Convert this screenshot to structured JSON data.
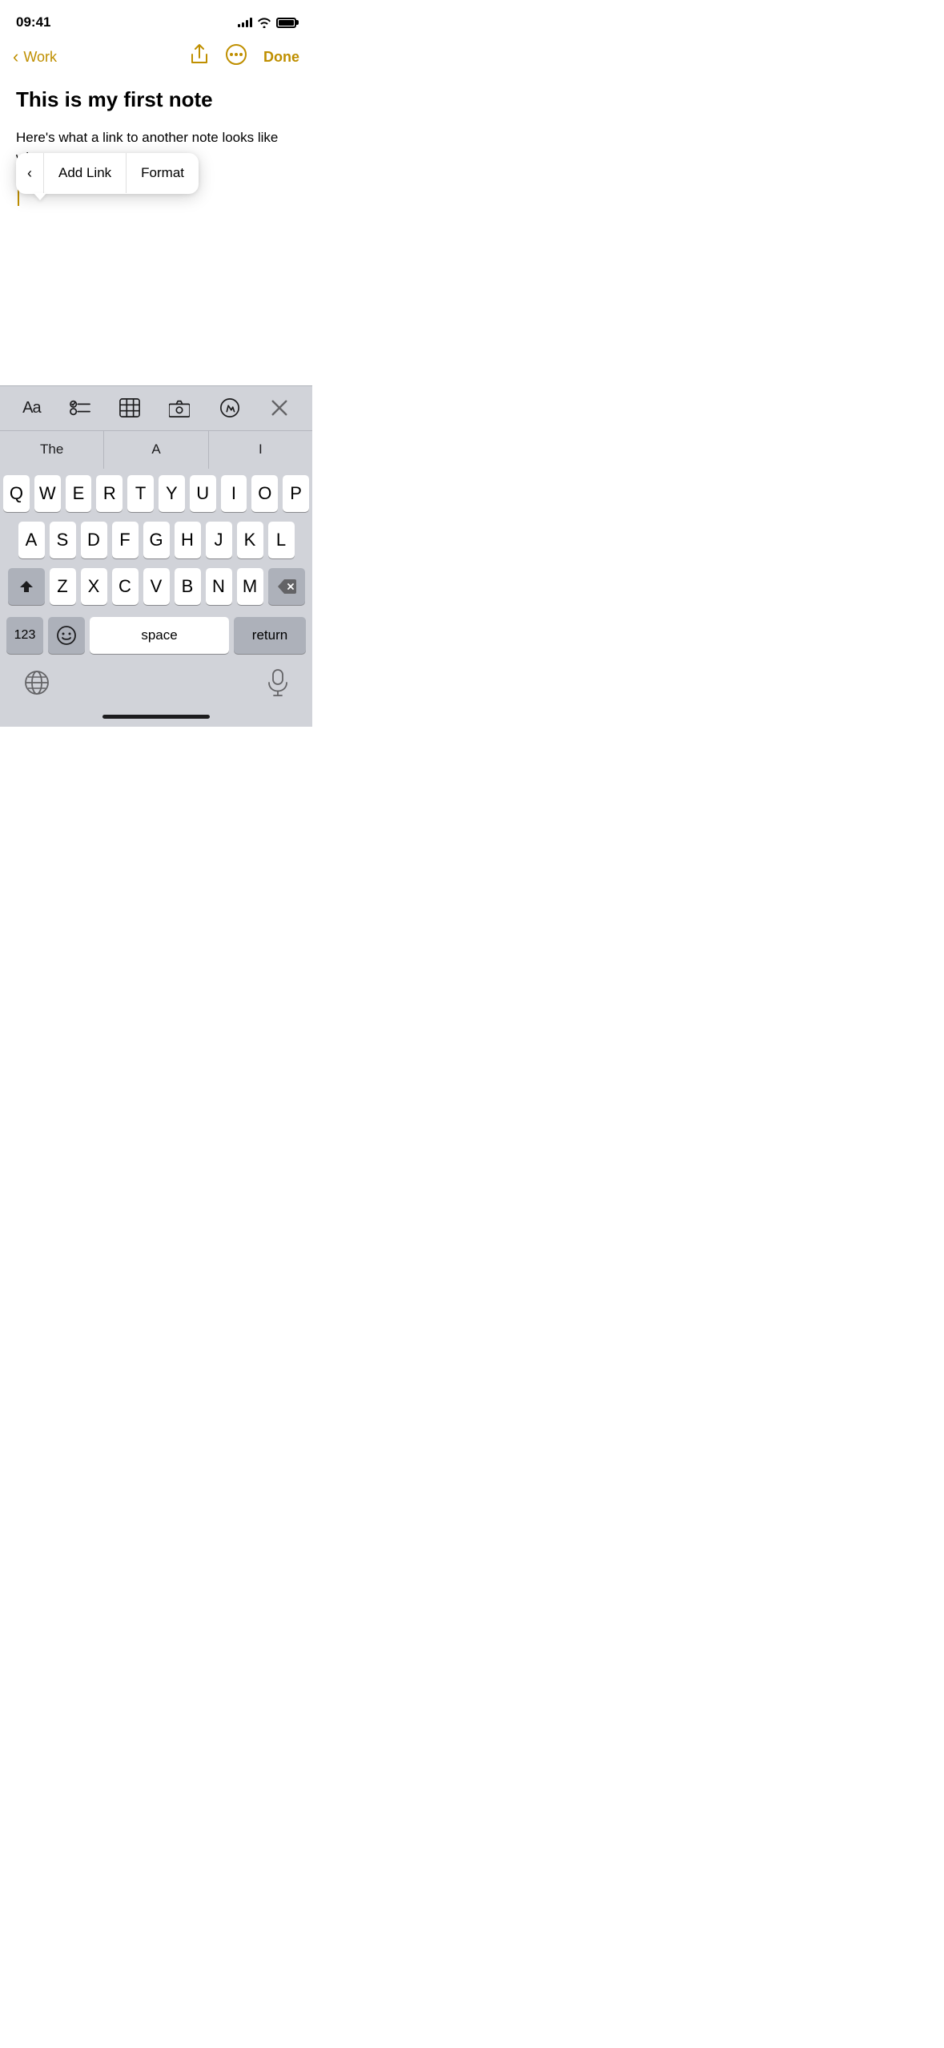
{
  "statusBar": {
    "time": "09:41"
  },
  "navBar": {
    "backLabel": "Work",
    "doneLabel": "Done"
  },
  "note": {
    "title": "This is my first note",
    "bodyText": "Here's what a link to another note looks like when"
  },
  "popupMenu": {
    "backIcon": "‹",
    "addLinkLabel": "Add Link",
    "formatLabel": "Format"
  },
  "toolbar": {
    "aaLabel": "Aa",
    "closeLabel": "×"
  },
  "suggestions": {
    "items": [
      "The",
      "A",
      "I"
    ]
  },
  "keyboard": {
    "row1": [
      "Q",
      "W",
      "E",
      "R",
      "T",
      "Y",
      "U",
      "I",
      "O",
      "P"
    ],
    "row2": [
      "A",
      "S",
      "D",
      "F",
      "G",
      "H",
      "J",
      "K",
      "L"
    ],
    "row3": [
      "Z",
      "X",
      "C",
      "V",
      "B",
      "N",
      "M"
    ],
    "spaceLabel": "space",
    "returnLabel": "return",
    "numbersLabel": "123"
  },
  "bottomIcons": {
    "globeIcon": "🌐",
    "micIcon": "mic"
  }
}
